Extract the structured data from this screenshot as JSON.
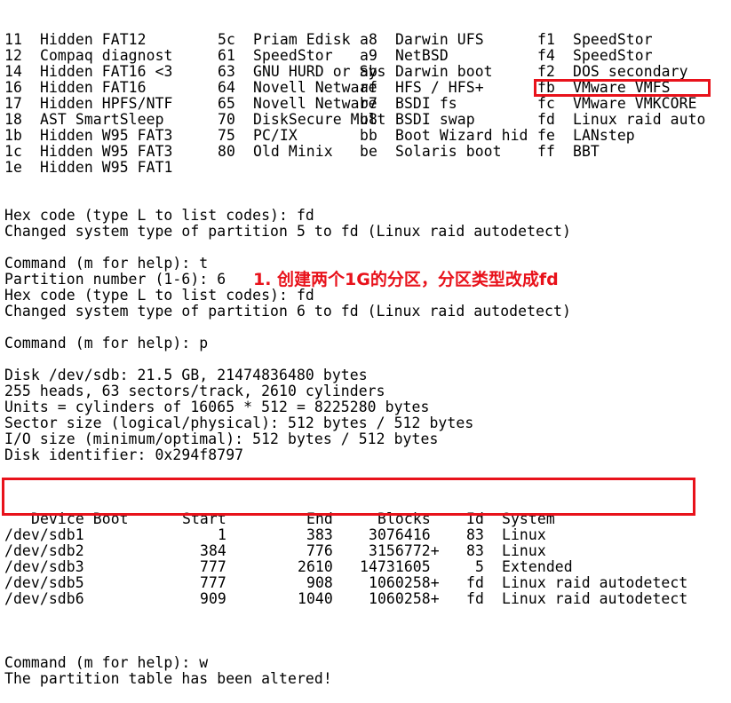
{
  "partition_types": [
    [
      "11",
      "Hidden FAT12",
      "5c",
      "Priam Edisk",
      "a8",
      "Darwin UFS",
      "f1",
      "SpeedStor"
    ],
    [
      "12",
      "Compaq diagnost",
      "61",
      "SpeedStor",
      "a9",
      "NetBSD",
      "f4",
      "SpeedStor"
    ],
    [
      "14",
      "Hidden FAT16 <3",
      "63",
      "GNU HURD or Sys",
      "ab",
      "Darwin boot",
      "f2",
      "DOS secondary"
    ],
    [
      "16",
      "Hidden FAT16",
      "64",
      "Novell Netware",
      "af",
      "HFS / HFS+",
      "fb",
      "VMware VMFS"
    ],
    [
      "17",
      "Hidden HPFS/NTF",
      "65",
      "Novell Netware",
      "b7",
      "BSDI fs",
      "fc",
      "VMware VMKCORE"
    ],
    [
      "18",
      "AST SmartSleep",
      "70",
      "DiskSecure Mult",
      "b8",
      "BSDI swap",
      "fd",
      "Linux raid auto"
    ],
    [
      "1b",
      "Hidden W95 FAT3",
      "75",
      "PC/IX",
      "bb",
      "Boot Wizard hid",
      "fe",
      "LANstep"
    ],
    [
      "1c",
      "Hidden W95 FAT3",
      "80",
      "Old Minix",
      "be",
      "Solaris boot",
      "ff",
      "BBT"
    ],
    [
      "1e",
      "Hidden W95 FAT1",
      "",
      "",
      "",
      "",
      "",
      ""
    ]
  ],
  "session_lines": [
    "Hex code (type L to list codes): fd",
    "Changed system type of partition 5 to fd (Linux raid autodetect)",
    "",
    "Command (m for help): t",
    "Partition number (1-6): 6",
    "Hex code (type L to list codes): fd",
    "Changed system type of partition 6 to fd (Linux raid autodetect)",
    "",
    "Command (m for help): p",
    "",
    "Disk /dev/sdb: 21.5 GB, 21474836480 bytes",
    "255 heads, 63 sectors/track, 2610 cylinders",
    "Units = cylinders of 16065 * 512 = 8225280 bytes",
    "Sector size (logical/physical): 512 bytes / 512 bytes",
    "I/O size (minimum/optimal): 512 bytes / 512 bytes",
    "Disk identifier: 0x294f8797",
    ""
  ],
  "partition_table": {
    "headers": [
      "Device Boot",
      "Start",
      "End",
      "Blocks",
      "Id",
      "System"
    ],
    "rows": [
      [
        "/dev/sdb1",
        "1",
        "383",
        "3076416",
        "83",
        "Linux"
      ],
      [
        "/dev/sdb2",
        "384",
        "776",
        "3156772+",
        "83",
        "Linux"
      ],
      [
        "/dev/sdb3",
        "777",
        "2610",
        "14731605",
        "5",
        "Extended"
      ],
      [
        "/dev/sdb5",
        "777",
        "908",
        "1060258+",
        "fd",
        "Linux raid autodetect"
      ],
      [
        "/dev/sdb6",
        "909",
        "1040",
        "1060258+",
        "fd",
        "Linux raid autodetect"
      ]
    ]
  },
  "closing_lines": [
    "",
    "Command (m for help): w",
    "The partition table has been altered!"
  ],
  "annotation": "1. 创建两个1G的分区，分区类型改成fd",
  "highlight_color": "#e8121b"
}
